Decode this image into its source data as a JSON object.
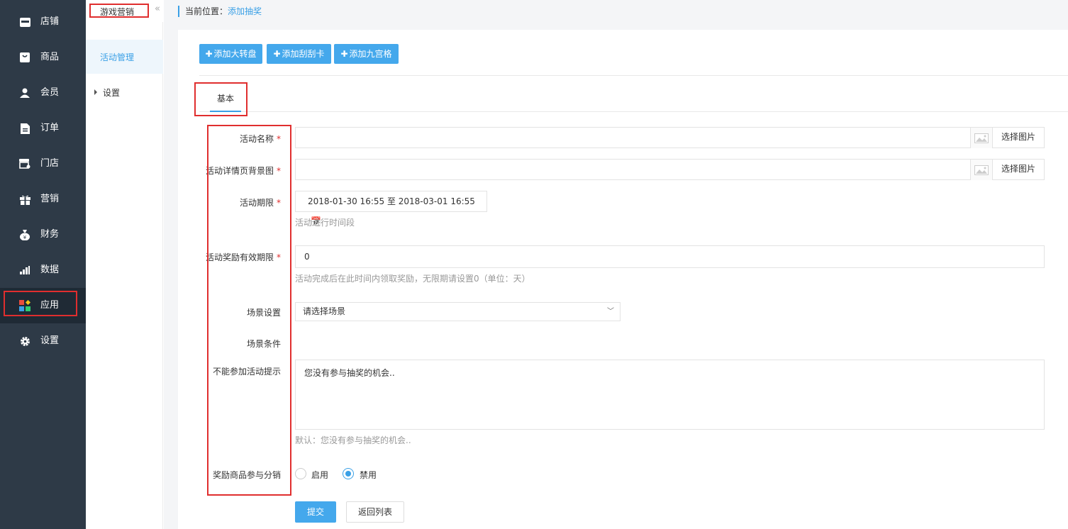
{
  "sidebar": {
    "items": [
      {
        "label": "店铺",
        "icon": "store-icon"
      },
      {
        "label": "商品",
        "icon": "goods-icon"
      },
      {
        "label": "会员",
        "icon": "user-icon"
      },
      {
        "label": "订单",
        "icon": "order-icon"
      },
      {
        "label": "门店",
        "icon": "shop-icon"
      },
      {
        "label": "营销",
        "icon": "gift-icon"
      },
      {
        "label": "财务",
        "icon": "money-bag-icon"
      },
      {
        "label": "数据",
        "icon": "bar-chart-icon"
      },
      {
        "label": "应用",
        "icon": "apps-icon"
      },
      {
        "label": "设置",
        "icon": "gear-icon"
      }
    ],
    "active_index": 8
  },
  "subnav": {
    "title": "游戏营销",
    "collapse": "«",
    "items": [
      {
        "label": "活动管理"
      },
      {
        "label": "设置"
      }
    ]
  },
  "breadcrumb": {
    "prefix": "当前位置：",
    "current": "添加抽奖"
  },
  "toolbar": {
    "buttons": [
      {
        "label": "添加大转盘"
      },
      {
        "label": "添加刮刮卡"
      },
      {
        "label": "添加九宫格"
      }
    ]
  },
  "tabs": [
    {
      "label": "基本"
    }
  ],
  "form": {
    "name_label": "活动名称",
    "bg_label": "活动详情页背景图",
    "pick_image": "选择图片",
    "period_label": "活动期限",
    "period_value": "2018-01-30 16:55 至 2018-03-01 16:55",
    "period_hint": "活动进行时间段",
    "reward_label": "活动奖励有效期限",
    "reward_value": "0",
    "reward_hint": "活动完成后在此时间内领取奖励，无限期请设置0（单位：天）",
    "scene_label": "场景设置",
    "scene_value": "请选择场景",
    "scene_cond_label": "场景条件",
    "tip_label": "不能参加活动提示",
    "tip_value": "您没有参与抽奖的机会..",
    "tip_hint": "默认：您没有参与抽奖的机会..",
    "dist_label": "奖励商品参与分销",
    "dist_options": [
      "启用",
      "禁用"
    ],
    "dist_selected": "禁用",
    "submit": "提交",
    "back": "返回列表"
  },
  "colors": {
    "sidebar_bg": "#2e3a47",
    "accent": "#44a8ec",
    "highlight_box": "#e02e2e"
  }
}
